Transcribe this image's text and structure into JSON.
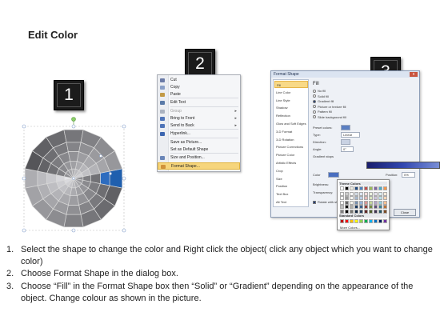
{
  "title": "Edit Color",
  "steps_badges": [
    "1",
    "2",
    "3"
  ],
  "context_menu": {
    "items": [
      {
        "label": "Cut",
        "disabled": false,
        "highlight": false,
        "icon": "scissors-icon",
        "color": "#6b7ba7"
      },
      {
        "label": "Copy",
        "disabled": false,
        "highlight": false,
        "icon": "copy-icon",
        "color": "#8aa0c8"
      },
      {
        "label": "Paste",
        "disabled": false,
        "highlight": false,
        "icon": "paste-icon",
        "color": "#c29a46"
      },
      {
        "label": "Edit Text",
        "disabled": false,
        "highlight": false,
        "icon": "edit-text-icon",
        "color": "#5a7aa8"
      },
      {
        "label": "Group",
        "disabled": true,
        "highlight": false,
        "icon": "group-icon",
        "color": "#aab2c0",
        "submenu": true
      },
      {
        "label": "Bring to Front",
        "disabled": false,
        "highlight": false,
        "icon": "bring-front-icon",
        "color": "#4f74b8",
        "submenu": true
      },
      {
        "label": "Send to Back",
        "disabled": false,
        "highlight": false,
        "icon": "send-back-icon",
        "color": "#4f74b8",
        "submenu": true
      },
      {
        "label": "Hyperlink...",
        "disabled": false,
        "highlight": false,
        "icon": "hyperlink-icon",
        "color": "#3c66b0"
      },
      {
        "label": "Save as Picture...",
        "disabled": false,
        "highlight": false,
        "icon": "",
        "color": ""
      },
      {
        "label": "Set as Default Shape",
        "disabled": false,
        "highlight": false,
        "icon": "",
        "color": ""
      },
      {
        "label": "Size and Position...",
        "disabled": false,
        "highlight": false,
        "icon": "size-position-icon",
        "color": "#6a86b8"
      },
      {
        "label": "Format Shape...",
        "disabled": false,
        "highlight": true,
        "icon": "format-shape-icon",
        "color": "#d0923a"
      }
    ]
  },
  "dialog": {
    "title": "Format Shape",
    "close_label": "x",
    "nav": [
      "Fill",
      "Line Color",
      "Line Style",
      "Shadow",
      "Reflection",
      "Glow and Soft Edges",
      "3-D Format",
      "3-D Rotation",
      "Picture Corrections",
      "Picture Color",
      "Artistic Effects",
      "Crop",
      "Size",
      "Position",
      "Text Box",
      "Alt Text"
    ],
    "nav_selected": "Fill",
    "heading": "Fill",
    "fill_options": [
      {
        "label": "No fill",
        "selected": false
      },
      {
        "label": "Solid fill",
        "selected": false
      },
      {
        "label": "Gradient fill",
        "selected": true
      },
      {
        "label": "Picture or texture fill",
        "selected": false
      },
      {
        "label": "Pattern fill",
        "selected": false
      },
      {
        "label": "Slide background fill",
        "selected": false
      }
    ],
    "preset_colors_label": "Preset colors:",
    "type_label": "Type:",
    "type_value": "Linear",
    "direction_label": "Direction:",
    "angle_label": "Angle:",
    "angle_value": "0°",
    "gradient_stops_label": "Gradient stops",
    "color_label": "Color",
    "position_label": "Position:",
    "position_value": "0%",
    "brightness_label": "Brightness:",
    "transparency_label": "Transparency:",
    "rotate_label": "Rotate with shape",
    "close_button": "Close"
  },
  "color_popup": {
    "theme_label": "Theme Colors",
    "standard_label": "Standard Colors",
    "more_label": "More Colors...",
    "theme_top": [
      "#ffffff",
      "#000000",
      "#eeece1",
      "#1f497d",
      "#4f81bd",
      "#c0504d",
      "#9bbb59",
      "#8064a2",
      "#4bacc6",
      "#f79646"
    ],
    "standard": [
      "#c00000",
      "#ff0000",
      "#ffc000",
      "#ffff00",
      "#92d050",
      "#00b050",
      "#00b0f0",
      "#0070c0",
      "#002060",
      "#7030a0"
    ]
  },
  "instructions": [
    {
      "n": "1.",
      "text": "Select the shape to change the color and Right click the object( click any object which you want to change color)"
    },
    {
      "n": "2.",
      "text": "Choose Format Shape in the dialog box."
    },
    {
      "n": "3.",
      "text": "Choose “Fill” in the Format Shape box then “Solid” or “Gradient” depending on the appearance of the object. Change colour as shown in the picture."
    }
  ],
  "colors": {
    "highlight_blue": "#1f5fae",
    "badge_bg": "#1b1b1b",
    "menu_highlight": "#f6d57c"
  }
}
